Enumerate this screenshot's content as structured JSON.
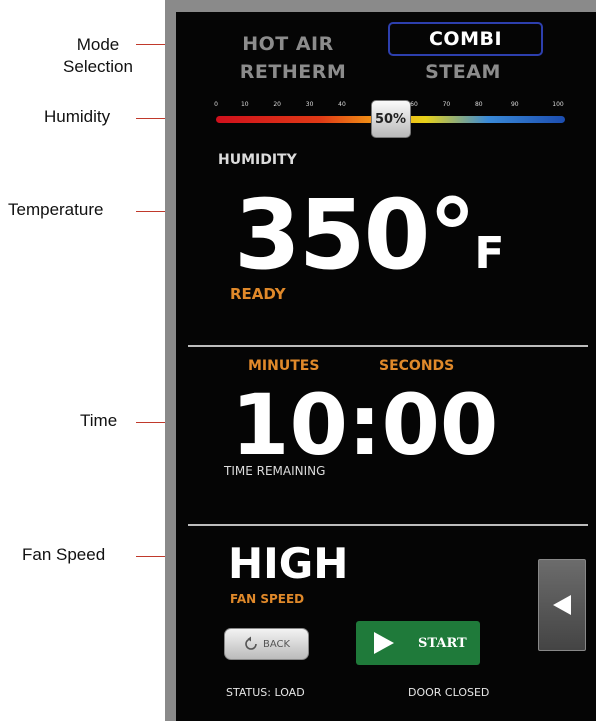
{
  "callouts": {
    "mode_line1": "Mode",
    "mode_line2": "Selection",
    "humidity": "Humidity",
    "temperature": "Temperature",
    "time": "Time",
    "fan_speed": "Fan Speed"
  },
  "modes": {
    "hot_air": "HOT AIR",
    "combi": "COMBI",
    "retherm": "RETHERM",
    "steam": "STEAM",
    "selected": "COMBI"
  },
  "humidity": {
    "ticks": [
      "0",
      "10",
      "20",
      "30",
      "40",
      "50",
      "60",
      "70",
      "80",
      "90",
      "100"
    ],
    "value_label": "50%",
    "level_percent": 50,
    "label": "HUMIDITY"
  },
  "temperature": {
    "value": "350°",
    "unit": "F",
    "status": "READY"
  },
  "time": {
    "minutes_label": "MINUTES",
    "seconds_label": "SECONDS",
    "value": "10:00",
    "remaining_label": "TIME REMAINING"
  },
  "fan": {
    "value": "HIGH",
    "label": "FAN SPEED"
  },
  "buttons": {
    "back": "BACK",
    "start": "START"
  },
  "status": {
    "left": "STATUS: LOAD",
    "right": "DOOR CLOSED"
  },
  "colors": {
    "accent_orange": "#e0892a",
    "selected_border": "#2d3fae",
    "start_green": "#1f7a3a"
  }
}
